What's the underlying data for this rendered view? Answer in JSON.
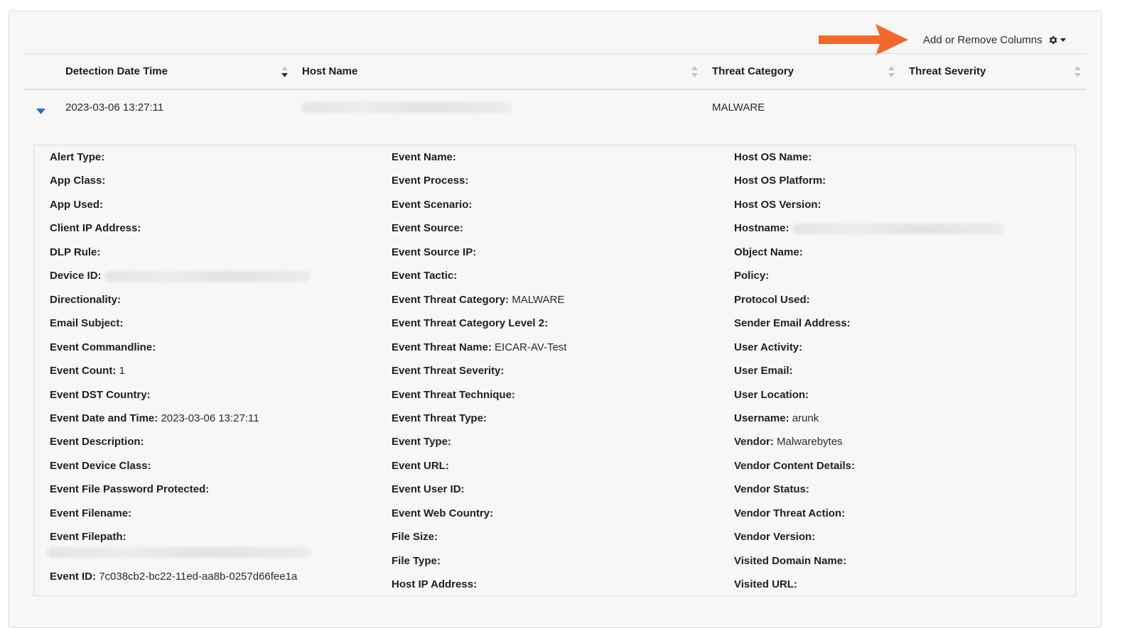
{
  "toolbar": {
    "columns_label": "Add or Remove Columns",
    "gear_icon": "gear-icon",
    "arrow_color": "#f2692b"
  },
  "table": {
    "headers": [
      "Detection Date Time",
      "Host Name",
      "Threat Category",
      "Threat Severity"
    ],
    "row": {
      "detection_date_time": "2023-03-06 13:27:11",
      "host_name": "",
      "threat_category": "MALWARE",
      "threat_severity": ""
    }
  },
  "details": {
    "col1": [
      {
        "label": "Alert Type:",
        "value": ""
      },
      {
        "label": "App Class:",
        "value": ""
      },
      {
        "label": "App Used:",
        "value": ""
      },
      {
        "label": "Client IP Address:",
        "value": ""
      },
      {
        "label": "DLP Rule:",
        "value": ""
      },
      {
        "label": "Device ID:",
        "value": ""
      },
      {
        "label": "Directionality:",
        "value": ""
      },
      {
        "label": "Email Subject:",
        "value": ""
      },
      {
        "label": "Event Commandline:",
        "value": ""
      },
      {
        "label": "Event Count:",
        "value": "1"
      },
      {
        "label": "Event DST Country:",
        "value": ""
      },
      {
        "label": "Event Date and Time:",
        "value": "2023-03-06 13:27:11"
      },
      {
        "label": "Event Description:",
        "value": ""
      },
      {
        "label": "Event Device Class:",
        "value": ""
      },
      {
        "label": "Event File Password Protected:",
        "value": ""
      },
      {
        "label": "Event Filename:",
        "value": ""
      },
      {
        "label": "Event Filepath:",
        "value": ""
      },
      {
        "label": "Event ID:",
        "value": "7c038cb2-bc22-11ed-aa8b-0257d66fee1a"
      }
    ],
    "col2": [
      {
        "label": "Event Name:",
        "value": ""
      },
      {
        "label": "Event Process:",
        "value": ""
      },
      {
        "label": "Event Scenario:",
        "value": ""
      },
      {
        "label": "Event Source:",
        "value": ""
      },
      {
        "label": "Event Source IP:",
        "value": ""
      },
      {
        "label": "Event Tactic:",
        "value": ""
      },
      {
        "label": "Event Threat Category:",
        "value": "MALWARE"
      },
      {
        "label": "Event Threat Category Level 2:",
        "value": ""
      },
      {
        "label": "Event Threat Name:",
        "value": "EICAR-AV-Test"
      },
      {
        "label": "Event Threat Severity:",
        "value": ""
      },
      {
        "label": "Event Threat Technique:",
        "value": ""
      },
      {
        "label": "Event Threat Type:",
        "value": ""
      },
      {
        "label": "Event Type:",
        "value": ""
      },
      {
        "label": "Event URL:",
        "value": ""
      },
      {
        "label": "Event User ID:",
        "value": ""
      },
      {
        "label": "Event Web Country:",
        "value": ""
      },
      {
        "label": "File Size:",
        "value": ""
      },
      {
        "label": "File Type:",
        "value": ""
      },
      {
        "label": "Host IP Address:",
        "value": ""
      }
    ],
    "col3": [
      {
        "label": "Host OS Name:",
        "value": ""
      },
      {
        "label": "Host OS Platform:",
        "value": ""
      },
      {
        "label": "Host OS Version:",
        "value": ""
      },
      {
        "label": "Hostname:",
        "value": ""
      },
      {
        "label": "Object Name:",
        "value": ""
      },
      {
        "label": "Policy:",
        "value": ""
      },
      {
        "label": "Protocol Used:",
        "value": ""
      },
      {
        "label": "Sender Email Address:",
        "value": ""
      },
      {
        "label": "User Activity:",
        "value": ""
      },
      {
        "label": "User Email:",
        "value": ""
      },
      {
        "label": "User Location:",
        "value": ""
      },
      {
        "label": "Username:",
        "value": "arunk"
      },
      {
        "label": "Vendor:",
        "value": "Malwarebytes"
      },
      {
        "label": "Vendor Content Details:",
        "value": ""
      },
      {
        "label": "Vendor Status:",
        "value": ""
      },
      {
        "label": "Vendor Threat Action:",
        "value": ""
      },
      {
        "label": "Vendor Version:",
        "value": ""
      },
      {
        "label": "Visited Domain Name:",
        "value": ""
      },
      {
        "label": "Visited URL:",
        "value": ""
      }
    ]
  }
}
